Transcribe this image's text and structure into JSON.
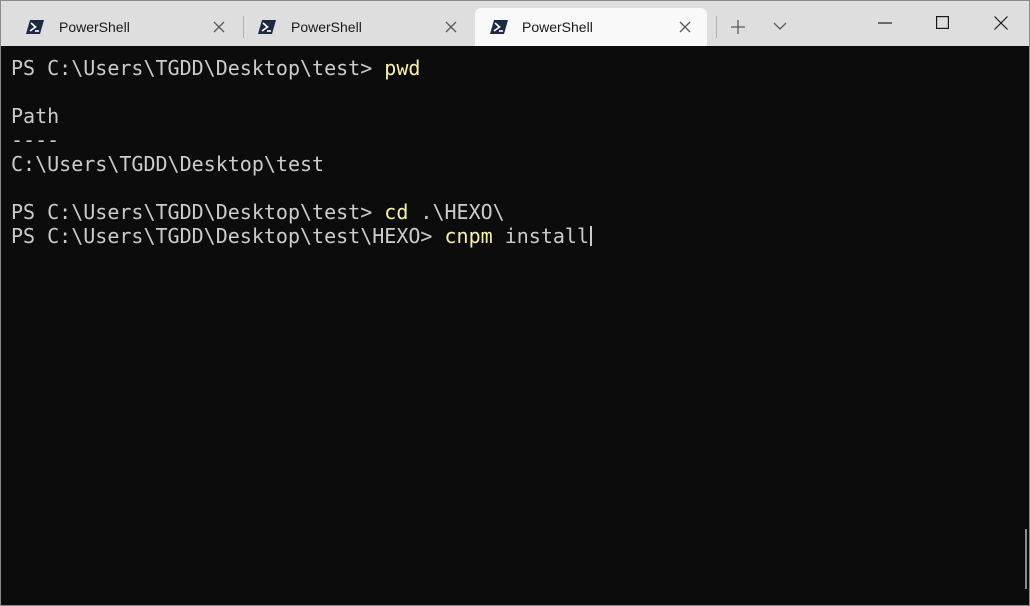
{
  "tabs": [
    {
      "title": "PowerShell",
      "icon": "powershell-icon",
      "active": false
    },
    {
      "title": "PowerShell",
      "icon": "powershell-icon",
      "active": false
    },
    {
      "title": "PowerShell",
      "icon": "powershell-icon",
      "active": true
    }
  ],
  "toolbar": {
    "new_tab_icon": "plus-icon",
    "dropdown_icon": "chevron-down-icon"
  },
  "window_controls": [
    "minimize-icon",
    "maximize-icon",
    "close-icon"
  ],
  "terminal": {
    "lines": [
      {
        "prompt": "PS C:\\Users\\TGDD\\Desktop\\test> ",
        "cmd": "pwd",
        "args": ""
      },
      {
        "text": ""
      },
      {
        "text": "Path"
      },
      {
        "text": "----"
      },
      {
        "text": "C:\\Users\\TGDD\\Desktop\\test"
      },
      {
        "text": ""
      },
      {
        "prompt": "PS C:\\Users\\TGDD\\Desktop\\test> ",
        "cmd": "cd",
        "args": " .\\HEXO\\"
      },
      {
        "prompt": "PS C:\\Users\\TGDD\\Desktop\\test\\HEXO> ",
        "cmd": "cnpm",
        "args": " install",
        "cursor": true
      }
    ]
  },
  "colors": {
    "background": "#0c0c0c",
    "foreground": "#cccccc",
    "command": "#f9f1a5",
    "titlebar": "#dedede",
    "active_tab": "#f9f9f9"
  }
}
